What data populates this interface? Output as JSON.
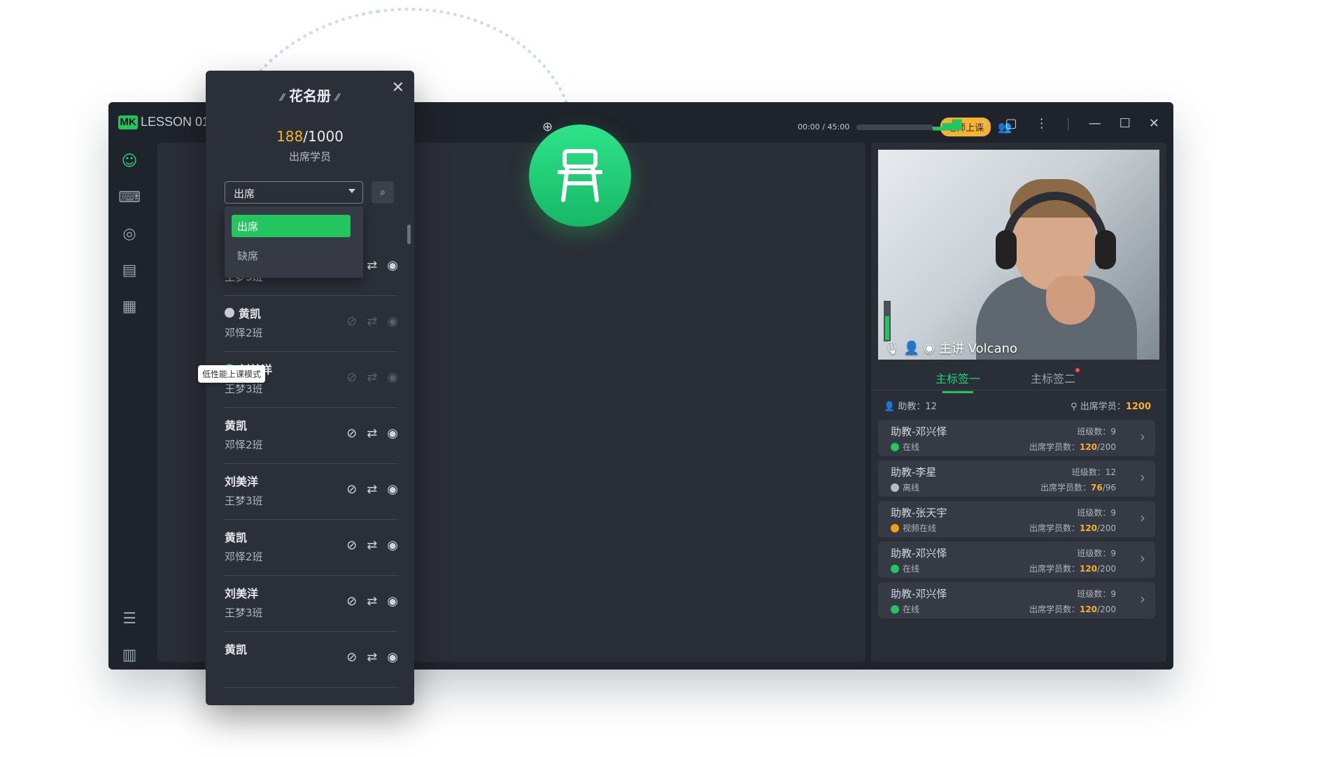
{
  "app": {
    "logo_mark": "MK",
    "title": "LESSON 01",
    "timer": "00:00 / 45:00",
    "teacher_status": "老师上课"
  },
  "sidebar": {
    "items": [
      "roster-icon",
      "text-icon",
      "broadcast-icon",
      "notes-icon",
      "apps-icon",
      "list-icon",
      "library-icon"
    ]
  },
  "roster": {
    "title": "花名册",
    "present": "188",
    "total": "/1000",
    "label": "出席学员",
    "filter_selected": "出席",
    "filter_options": [
      "出席",
      "缺席"
    ],
    "rows": [
      {
        "name": "刘美洋",
        "class": "王梦3班",
        "status": "",
        "dim": false
      },
      {
        "name": "黄凯",
        "class": "邓怿2班",
        "status": "offline",
        "dim": true
      },
      {
        "name": "刘美洋",
        "class": "王梦3班",
        "status": "online",
        "dim": true
      },
      {
        "name": "黄凯",
        "class": "邓怿2班",
        "status": "",
        "dim": false
      },
      {
        "name": "刘美洋",
        "class": "王梦3班",
        "status": "",
        "dim": false
      },
      {
        "name": "黄凯",
        "class": "邓怿2班",
        "status": "",
        "dim": false
      },
      {
        "name": "刘美洋",
        "class": "王梦3班",
        "status": "",
        "dim": false
      },
      {
        "name": "黄凯",
        "class": "",
        "status": "",
        "dim": false
      }
    ],
    "tooltip": "低性能上课模式"
  },
  "video": {
    "speaker_label": "主讲 Volcano"
  },
  "right_tabs": [
    "主标签一",
    "主标签二"
  ],
  "stats": {
    "assistants_label": "助教：",
    "assistants": "12",
    "students_label": "出席学员：",
    "students": "1200"
  },
  "cards": [
    {
      "name": "助教-邓兴怿",
      "status": "在线",
      "status_color": "#22c55e",
      "class_label": "班级数：",
      "class_count": "9",
      "present_label": "出席学员数：",
      "present": "120",
      "cap": "/200"
    },
    {
      "name": "助教-李星",
      "status": "离线",
      "status_color": "#b6bcc6",
      "class_label": "班级数：",
      "class_count": "12",
      "present_label": "出席学员数：",
      "present": "76",
      "cap": "/96"
    },
    {
      "name": "助教-张天宇",
      "status": "视频在线",
      "status_color": "#f59e0b",
      "class_label": "班级数：",
      "class_count": "9",
      "present_label": "出席学员数：",
      "present": "120",
      "cap": "/200"
    },
    {
      "name": "助教-邓兴怿",
      "status": "在线",
      "status_color": "#22c55e",
      "class_label": "班级数：",
      "class_count": "9",
      "present_label": "出席学员数：",
      "present": "120",
      "cap": "/200"
    },
    {
      "name": "助教-邓兴怿",
      "status": "在线",
      "status_color": "#22c55e",
      "class_label": "班级数：",
      "class_count": "9",
      "present_label": "出席学员数：",
      "present": "120",
      "cap": "/200"
    }
  ],
  "colors": {
    "accent": "#22c55e",
    "highlight": "#f5b335"
  }
}
